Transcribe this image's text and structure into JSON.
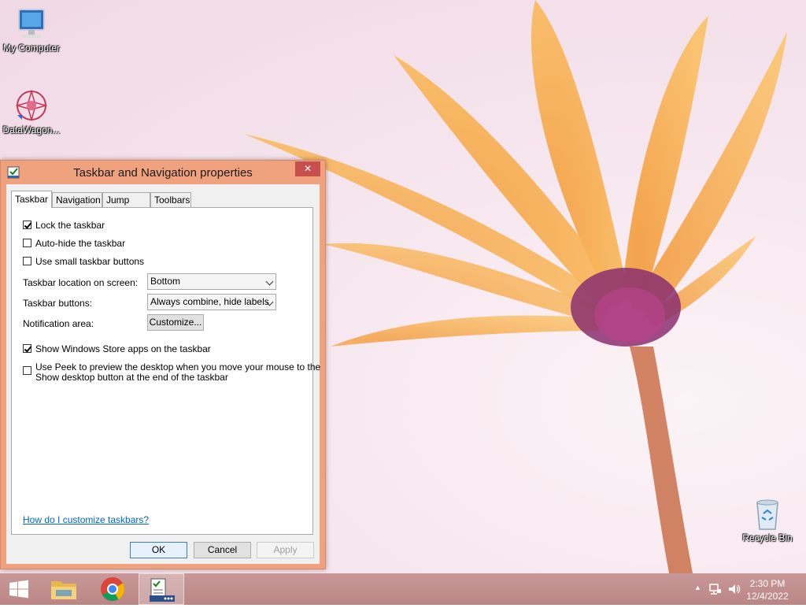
{
  "desktop": {
    "icons": [
      {
        "label": "My Computer",
        "icon": "computer-icon"
      },
      {
        "label": "DataWagon...",
        "icon": "datawagon-icon"
      },
      {
        "label": "Recycle Bin",
        "icon": "recycle-bin-icon"
      }
    ]
  },
  "dialog": {
    "title": "Taskbar and Navigation properties",
    "close_glyph": "✕",
    "tabs": [
      "Taskbar",
      "Navigation",
      "Jump Lists",
      "Toolbars"
    ],
    "active_tab": "Taskbar",
    "checkboxes": {
      "lock": {
        "label": "Lock the taskbar",
        "checked": true
      },
      "autohide": {
        "label": "Auto-hide the taskbar",
        "checked": false
      },
      "small": {
        "label": "Use small taskbar buttons",
        "checked": false
      },
      "store_apps": {
        "label": "Show Windows Store apps on the taskbar",
        "checked": true
      },
      "peek": {
        "label_line1": "Use Peek to preview the desktop when you move your mouse to the",
        "label_line2": "Show desktop button at the end of the taskbar",
        "checked": false
      }
    },
    "location": {
      "label": "Taskbar location on screen:",
      "value": "Bottom"
    },
    "buttons_setting": {
      "label": "Taskbar buttons:",
      "value": "Always combine, hide labels"
    },
    "notification": {
      "label": "Notification area:",
      "button": "Customize..."
    },
    "help_link": "How do I customize taskbars?",
    "ok": "OK",
    "cancel": "Cancel",
    "apply": "Apply"
  },
  "taskbar": {
    "time": "2:30 PM",
    "date": "12/4/2022",
    "show_hidden_glyph": "▲"
  },
  "colors": {
    "dialog_frame": "#f0a17e",
    "close_button": "#c7504f",
    "taskbar": "#c08b8b",
    "link": "#0066cc"
  }
}
